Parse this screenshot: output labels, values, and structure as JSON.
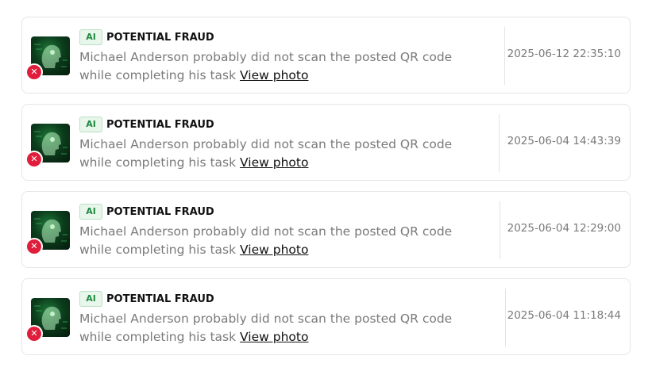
{
  "notifications": [
    {
      "ai_tag": "AI",
      "title": "POTENTIAL FRAUD",
      "message_line1": "Michael Anderson probably did not scan the posted QR code",
      "message_line2": "while completing his task",
      "link_label": "View photo",
      "timestamp": "2025-06-12 22:35:10",
      "status_icon": "x-icon",
      "status_color": "#e01e3c"
    },
    {
      "ai_tag": "AI",
      "title": "POTENTIAL FRAUD",
      "message_line1": "Michael Anderson probably did not scan the posted QR code",
      "message_line2": "while completing his task",
      "link_label": "View photo",
      "timestamp": "2025-06-04 14:43:39",
      "status_icon": "x-icon",
      "status_color": "#e01e3c"
    },
    {
      "ai_tag": "AI",
      "title": "POTENTIAL FRAUD",
      "message_line1": "Michael Anderson probably did not scan the posted QR code",
      "message_line2": "while completing his task",
      "link_label": "View photo",
      "timestamp": "2025-06-04 12:29:00",
      "status_icon": "x-icon",
      "status_color": "#e01e3c"
    },
    {
      "ai_tag": "AI",
      "title": "POTENTIAL FRAUD",
      "message_line1": "Michael Anderson probably did not scan the posted QR code",
      "message_line2": "while completing his task",
      "link_label": "View photo",
      "timestamp": "2025-06-04 11:18:44",
      "status_icon": "x-icon",
      "status_color": "#e01e3c"
    }
  ]
}
